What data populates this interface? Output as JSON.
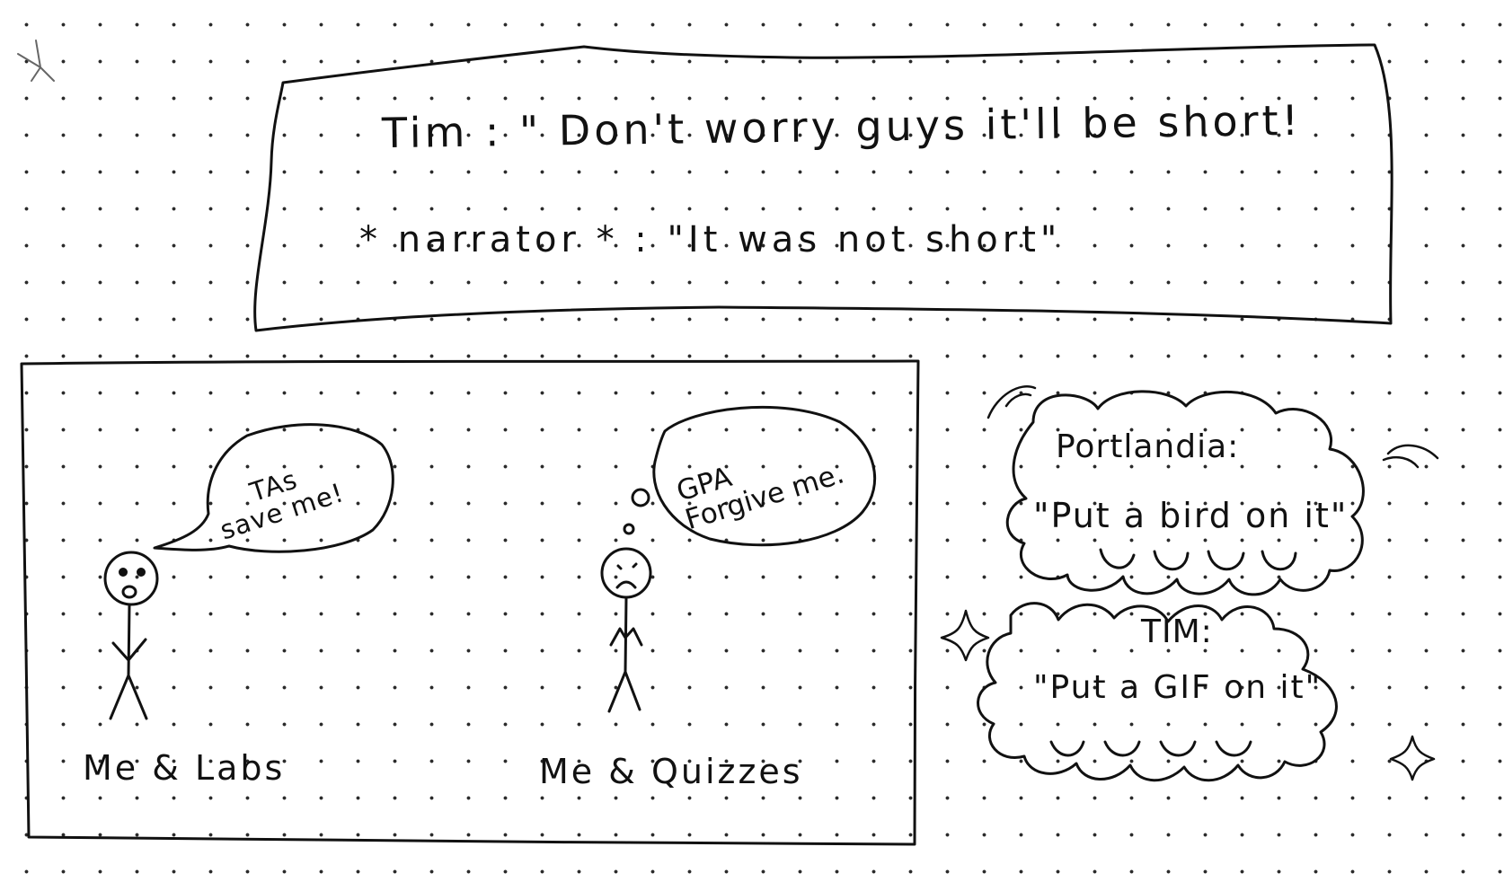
{
  "banner": {
    "line1": "Tim : \" Don't worry guys it'll be short!",
    "line2": "* narrator * : \"It was not short\""
  },
  "panel": {
    "left": {
      "speech": "TAs\nsave me!",
      "caption": "Me & Labs"
    },
    "right": {
      "thought": "GPA\nForgive me.",
      "caption": "Me & Quizzes"
    }
  },
  "clouds": {
    "top": {
      "speaker": "Portlandia:",
      "quote": "\"Put a bird on it\""
    },
    "bottom": {
      "speaker": "TIM:",
      "quote": "\"Put a GIF on it\""
    }
  },
  "icons": [
    "sparkle-icon",
    "sparkle-icon",
    "stick-figure-worried",
    "stick-figure-sad"
  ]
}
